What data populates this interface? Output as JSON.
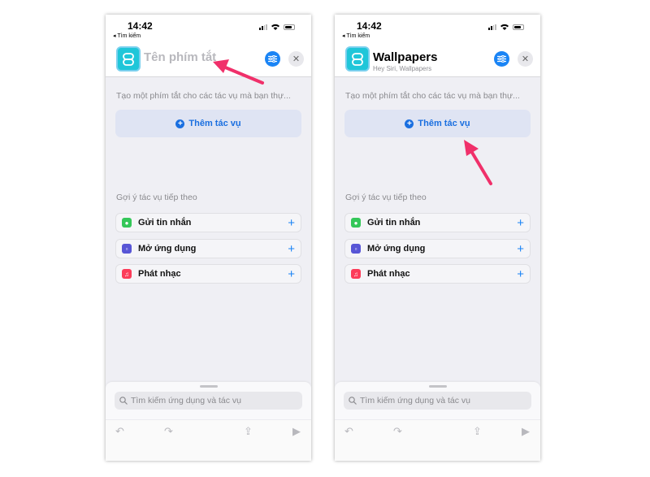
{
  "phones": [
    {
      "time": "14:42",
      "back": "Tìm kiếm",
      "title": "Tên phím tắt",
      "title_placeholder": true,
      "subtitle": "",
      "description": "Tạo một phím tắt cho các tác vụ mà bạn thự...",
      "add_action": "Thêm tác vụ",
      "suggestions_heading": "Gợi ý tác vụ tiếp theo",
      "suggestions": [
        {
          "label": "Gửi tin nhắn",
          "icon": "messages-icon"
        },
        {
          "label": "Mở ứng dụng",
          "icon": "open-app-icon"
        },
        {
          "label": "Phát nhạc",
          "icon": "music-icon"
        }
      ],
      "search_placeholder": "Tìm kiếm ứng dụng và tác vụ"
    },
    {
      "time": "14:42",
      "back": "Tìm kiếm",
      "title": "Wallpapers",
      "title_placeholder": false,
      "subtitle": "Hey Siri, Wallpapers",
      "description": "Tạo một phím tắt cho các tác vụ mà bạn thự...",
      "add_action": "Thêm tác vụ",
      "suggestions_heading": "Gợi ý tác vụ tiếp theo",
      "suggestions": [
        {
          "label": "Gửi tin nhắn",
          "icon": "messages-icon"
        },
        {
          "label": "Mở ứng dụng",
          "icon": "open-app-icon"
        },
        {
          "label": "Phát nhạc",
          "icon": "music-icon"
        }
      ],
      "search_placeholder": "Tìm kiếm ứng dụng và tác vụ"
    }
  ],
  "colors": {
    "accent": "#1a84f5",
    "annotation_arrow": "#f0306a",
    "shortcut_icon": "#1fc6d9",
    "messages": "#34c759",
    "open_app": "#5856d6",
    "music": "#fc3c5a"
  }
}
